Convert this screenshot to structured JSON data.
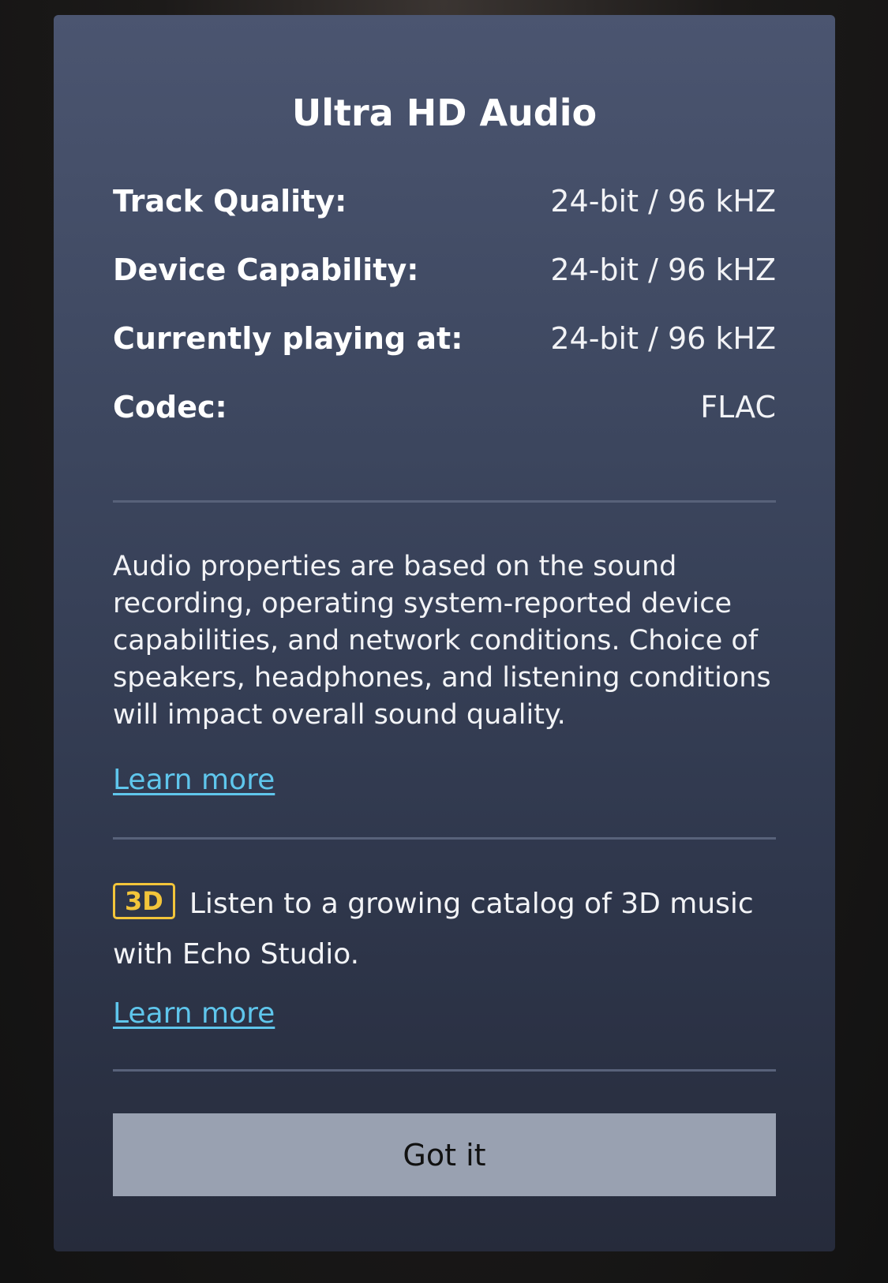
{
  "dialog": {
    "title": "Ultra HD Audio",
    "properties": [
      {
        "label": "Track Quality:",
        "value": "24-bit / 96 kHZ"
      },
      {
        "label": "Device Capability:",
        "value": "24-bit / 96 kHZ"
      },
      {
        "label": "Currently playing at:",
        "value": "24-bit / 96 kHZ"
      },
      {
        "label": "Codec:",
        "value": "FLAC"
      }
    ],
    "description": "Audio properties are based on the sound recording, operating system-reported device capabilities, and network conditions. Choice of speakers, headphones, and listening conditions will impact overall sound quality.",
    "learn_more_1": "Learn more",
    "promo_badge": "3D",
    "promo_text": "Listen to a growing catalog of 3D music with Echo Studio.",
    "learn_more_2": "Learn more",
    "button_label": "Got it"
  },
  "colors": {
    "link": "#5fc6ec",
    "badge": "#f3c53a",
    "button_bg": "#99a1b1"
  }
}
